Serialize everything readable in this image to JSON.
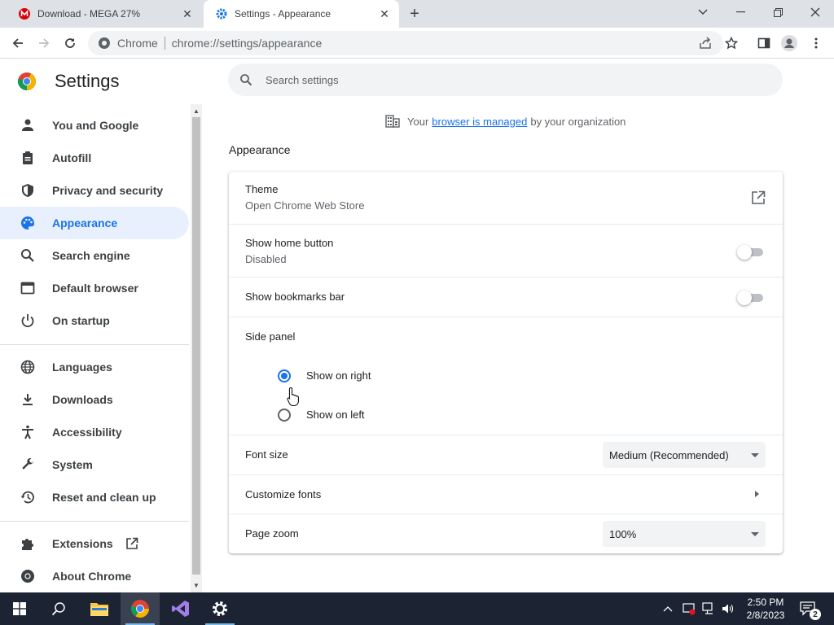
{
  "tabs": [
    {
      "title": "Download - MEGA 27%",
      "icon": "mega-icon",
      "color": "#d90007"
    },
    {
      "title": "Settings - Appearance",
      "icon": "settings-gear-icon",
      "color": "#1a73e8"
    }
  ],
  "toolbar": {
    "site_chip": "Chrome",
    "url": "chrome://settings/appearance"
  },
  "sidebar": {
    "title": "Settings",
    "items": [
      {
        "label": "You and Google",
        "icon": "person-icon"
      },
      {
        "label": "Autofill",
        "icon": "clipboard-icon"
      },
      {
        "label": "Privacy and security",
        "icon": "shield-icon"
      },
      {
        "label": "Appearance",
        "icon": "palette-icon",
        "selected": true
      },
      {
        "label": "Search engine",
        "icon": "search-icon"
      },
      {
        "label": "Default browser",
        "icon": "browser-window-icon"
      },
      {
        "label": "On startup",
        "icon": "power-icon"
      },
      {
        "label": "Languages",
        "icon": "globe-icon"
      },
      {
        "label": "Downloads",
        "icon": "download-icon"
      },
      {
        "label": "Accessibility",
        "icon": "accessibility-icon"
      },
      {
        "label": "System",
        "icon": "wrench-icon"
      },
      {
        "label": "Reset and clean up",
        "icon": "history-icon"
      },
      {
        "label": "Extensions",
        "icon": "puzzle-icon"
      },
      {
        "label": "About Chrome",
        "icon": "chrome-icon"
      }
    ]
  },
  "main": {
    "search_placeholder": "Search settings",
    "managed": {
      "prefix": "Your",
      "link": "browser is managed",
      "suffix": "by your organization"
    },
    "section_title": "Appearance",
    "theme": {
      "label": "Theme",
      "sub": "Open Chrome Web Store"
    },
    "home_button": {
      "label": "Show home button",
      "sub": "Disabled",
      "enabled": false
    },
    "bookmarks_bar": {
      "label": "Show bookmarks bar",
      "enabled": false
    },
    "side_panel": {
      "label": "Side panel",
      "options": [
        {
          "label": "Show on right",
          "selected": true
        },
        {
          "label": "Show on left",
          "selected": false
        }
      ]
    },
    "font_size": {
      "label": "Font size",
      "value": "Medium (Recommended)"
    },
    "customize_fonts": {
      "label": "Customize fonts"
    },
    "page_zoom": {
      "label": "Page zoom",
      "value": "100%"
    }
  },
  "taskbar": {
    "time": "2:50 PM",
    "date": "2/8/2023",
    "notification_count": "2"
  },
  "colors": {
    "accent": "#1a73e8",
    "selected_bg": "#e8f0fe",
    "taskbar": "#1c2433"
  }
}
